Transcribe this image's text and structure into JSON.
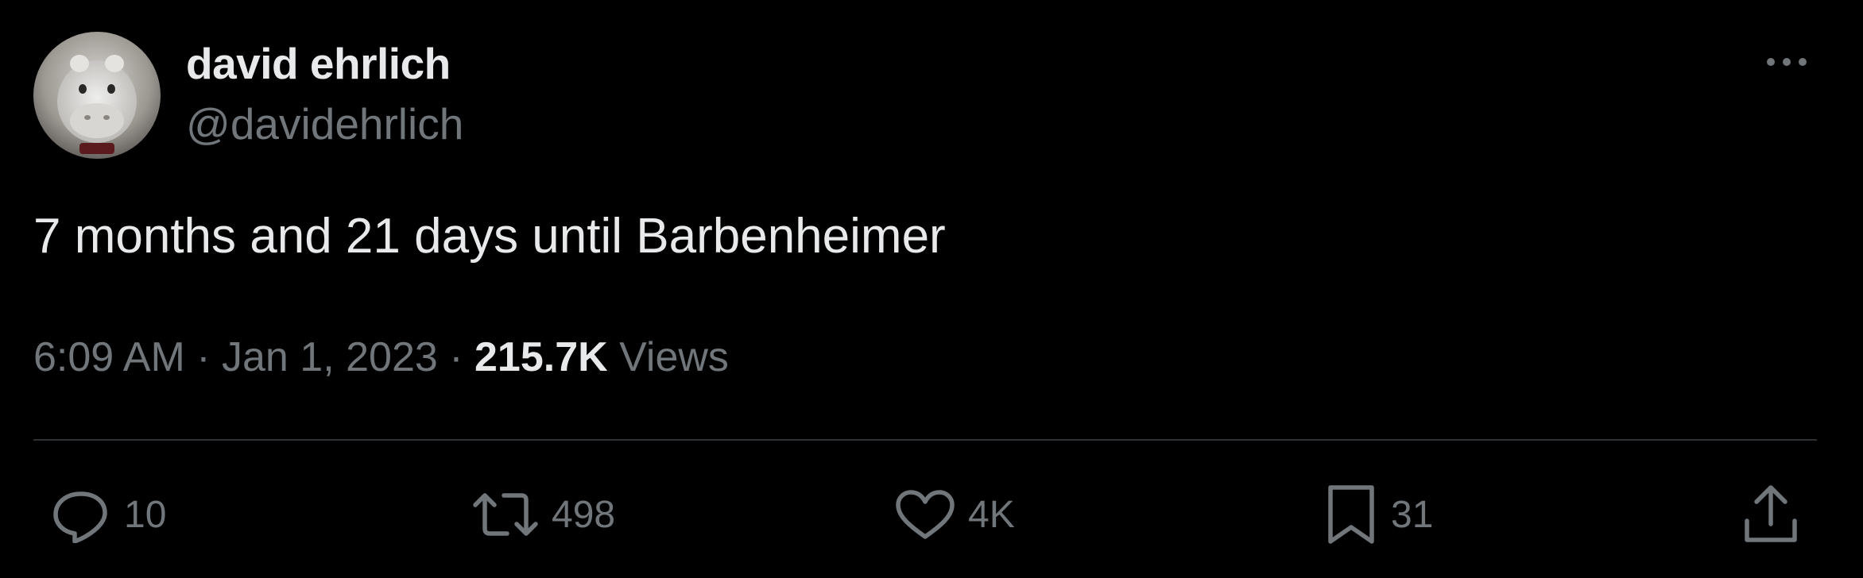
{
  "author": {
    "display_name": "david ehrlich",
    "handle": "@davidehrlich"
  },
  "tweet": {
    "text": "7 months and 21 days until Barbenheimer",
    "time": "6:09 AM",
    "separator": " · ",
    "date": "Jan 1, 2023",
    "views_count": "215.7K",
    "views_label": " Views"
  },
  "actions": {
    "replies": "10",
    "reposts": "498",
    "likes": "4K",
    "bookmarks": "31"
  },
  "icons": {
    "more": "more-dots-icon",
    "reply": "reply-icon",
    "repost": "repost-icon",
    "like": "heart-icon",
    "bookmark": "bookmark-icon",
    "share": "share-icon"
  },
  "colors": {
    "background": "#000000",
    "primary_text": "#e7e9ea",
    "secondary_text": "#71767b",
    "divider": "#2f3336"
  }
}
